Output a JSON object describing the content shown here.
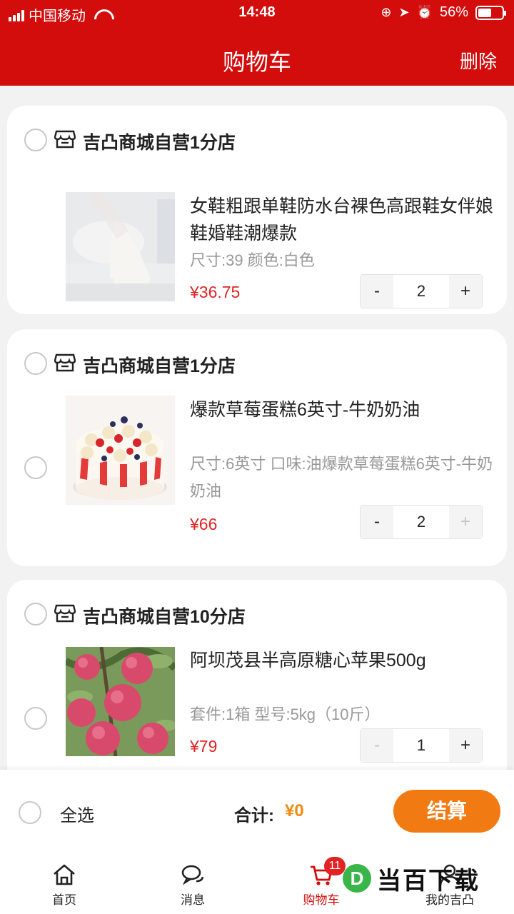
{
  "status_bar": {
    "carrier": "中国移动",
    "time": "14:48",
    "battery": "56%",
    "battery_level": 0.56
  },
  "header": {
    "title": "购物车",
    "delete_label": "删除",
    "bg_color": "#d30c0c"
  },
  "items": [
    {
      "store_name": "吉凸商城自营1分店",
      "product_name": "女鞋粗跟单鞋防水台裸色高跟鞋女伴娘鞋婚鞋潮爆款",
      "spec": "尺寸:39 颜色:白色",
      "price": "¥36.75",
      "minus": "-",
      "quantity": "2",
      "plus": "+",
      "image": "white-high-heel-shoe"
    },
    {
      "store_name": "吉凸商城自营1分店",
      "product_name": "爆款草莓蛋糕6英寸-牛奶奶油",
      "spec": "尺寸:6英寸 口味:油爆款草莓蛋糕6英寸-牛奶奶油",
      "price": "¥66",
      "minus": "-",
      "quantity": "2",
      "plus": "+",
      "image": "strawberry-cake"
    },
    {
      "store_name": "吉凸商城自营10分店",
      "product_name": "阿坝茂县半高原糖心苹果500g",
      "spec": "套件:1箱 型号:5kg（10斤）",
      "price": "¥79",
      "minus": "-",
      "quantity": "1",
      "plus": "+",
      "image": "red-apples"
    }
  ],
  "footer": {
    "select_all": "全选",
    "total_label": "合计:",
    "total_value": "¥0",
    "checkout": "结算",
    "checkout_color": "#f27a12"
  },
  "tabbar": {
    "tabs": [
      {
        "label": "首页",
        "icon": "home-icon"
      },
      {
        "label": "消息",
        "icon": "message-icon"
      },
      {
        "label": "购物车",
        "icon": "cart-icon",
        "badge": "11"
      },
      {
        "label": "我的吉凸",
        "icon": "user-icon"
      }
    ]
  },
  "watermark": {
    "logo": "D",
    "text": "当百下载"
  }
}
